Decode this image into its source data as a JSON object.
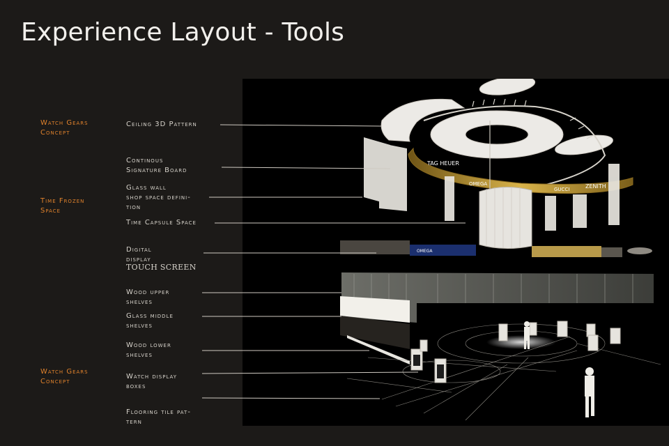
{
  "page": {
    "title": "Experience Layout - Tools"
  },
  "concepts": [
    {
      "id": "c1",
      "text": "Watch Gears\nConcept"
    },
    {
      "id": "c2",
      "text": "Time Frozen\nSpace"
    },
    {
      "id": "c3",
      "text": "Watch Gears\nConcept"
    }
  ],
  "labels": [
    {
      "id": "ceiling",
      "text": "Ceiling 3D Pattern"
    },
    {
      "id": "signature",
      "text": "Continous\nSignature Board"
    },
    {
      "id": "glasswall",
      "text": "Glass wall\n shop space defini-\ntion"
    },
    {
      "id": "capsule",
      "text": "Time Capsule Space"
    },
    {
      "id": "digital",
      "text": "Digital\ndisplay"
    },
    {
      "id": "touch",
      "text": "TOUCH SCREEN"
    },
    {
      "id": "woodupper",
      "text": "Wood upper\nshelves"
    },
    {
      "id": "glassmiddle",
      "text": "Glass middle\nshelves"
    },
    {
      "id": "woodlower",
      "text": "Wood lower\nshelves"
    },
    {
      "id": "watchbox",
      "text": "Watch display\nboxes"
    },
    {
      "id": "flooring",
      "text": "Flooring tile pat-\ntern"
    }
  ],
  "render": {
    "banner_brands": [
      "TAG HEUER",
      "OMEGA",
      "GUCCI",
      "ZENITH"
    ],
    "screen_brand": "OMEGA"
  },
  "colors": {
    "background": "#1c1a18",
    "accent": "#e0822c",
    "label": "#d6d2ca",
    "gold": "#b58d2a"
  }
}
